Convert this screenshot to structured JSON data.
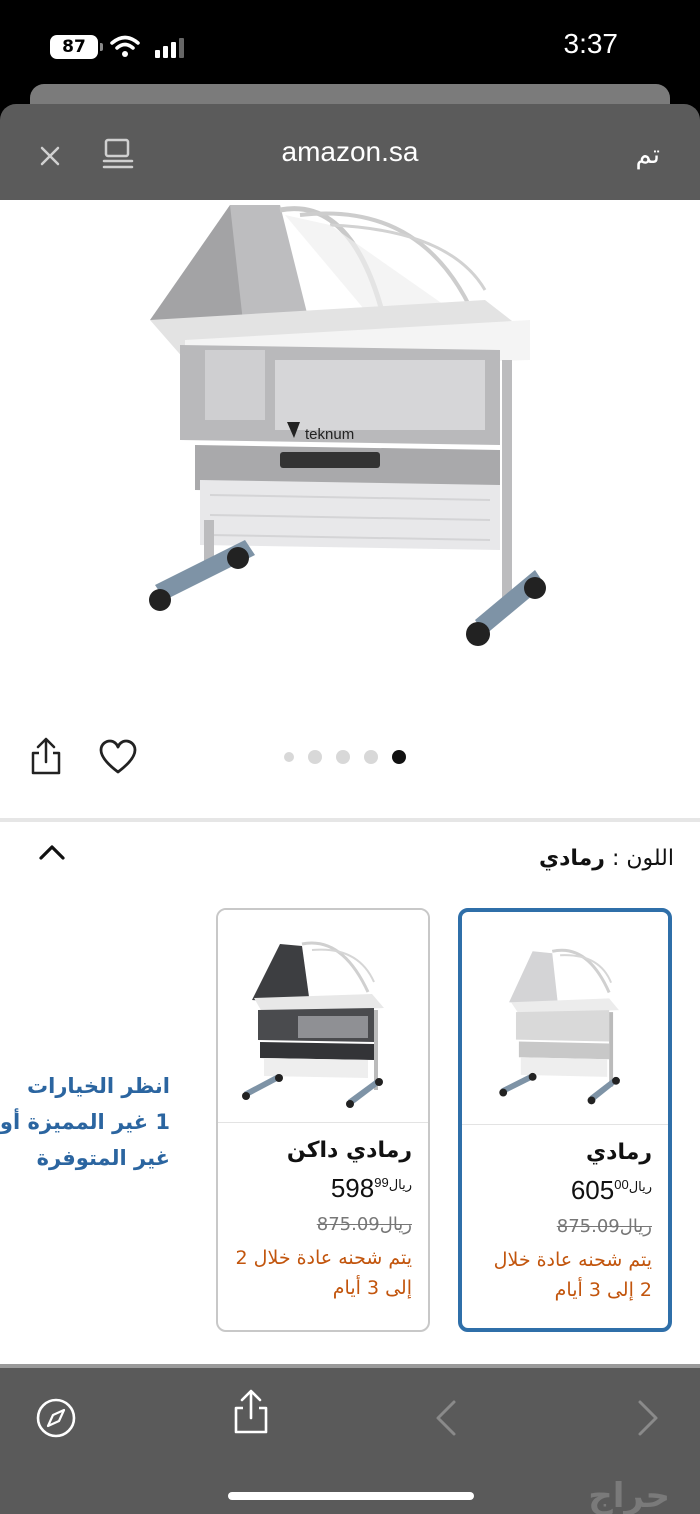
{
  "status_bar": {
    "time": "3:37",
    "battery": "87"
  },
  "header": {
    "domain": "amazon.sa",
    "done_label": "تم"
  },
  "product": {
    "image_brand": "teknum",
    "carousel_count": 5,
    "carousel_active_index": 4
  },
  "variation": {
    "label": "اللون :",
    "selected_value": "رمادي"
  },
  "options": [
    {
      "name": "رمادي",
      "currency": "ريال",
      "price_int": "605",
      "price_frac": "00",
      "old_price": "875.09ريال",
      "shipping": "يتم شحنه عادة خلال 2 إلى 3 أيام",
      "selected": true,
      "frame_color": "#d9d9d9"
    },
    {
      "name": "رمادي داكن",
      "currency": "ريال",
      "price_int": "598",
      "price_frac": "99",
      "old_price": "875.09ريال",
      "shipping": "يتم شحنه عادة خلال 2 إلى 3 أيام",
      "selected": false,
      "frame_color": "#3d3e41"
    }
  ],
  "more_options": {
    "line1": "انظر الخيارات",
    "line2": "1 غير المميزة أو",
    "line3": "غير المتوفرة"
  },
  "watermark": "حراج",
  "colors": {
    "accent_blue": "#2f6fa9",
    "shipping_orange": "#c2550d",
    "link_blue": "#2b65a0"
  }
}
